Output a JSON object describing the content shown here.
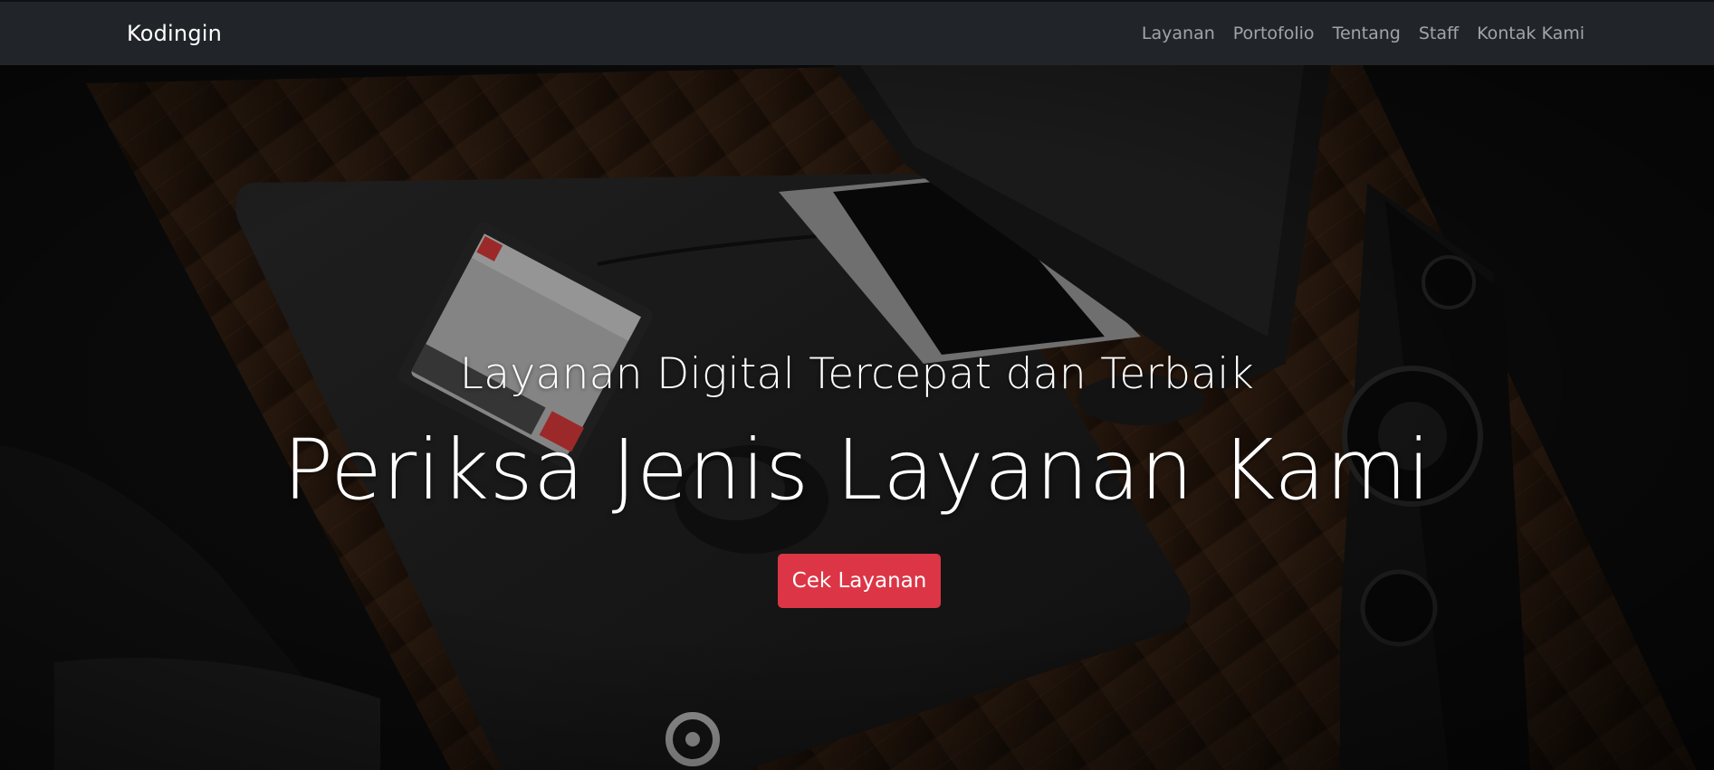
{
  "navbar": {
    "brand": "Kodingin",
    "links": [
      "Layanan",
      "Portofolio",
      "Tentang",
      "Staff",
      "Kontak Kami"
    ]
  },
  "hero": {
    "lead": "Layanan Digital Tercepat dan Terbaik",
    "title": "Periksa Jenis Layanan Kami",
    "button_label": "Cek Layanan",
    "background_image": "desk-setup-photo"
  },
  "colors": {
    "navbar_bg": "#212529",
    "brand_text": "#ffffff",
    "nav_link": "#a6a8aa",
    "button_bg": "#dc3545",
    "hero_text": "#ffffff"
  }
}
